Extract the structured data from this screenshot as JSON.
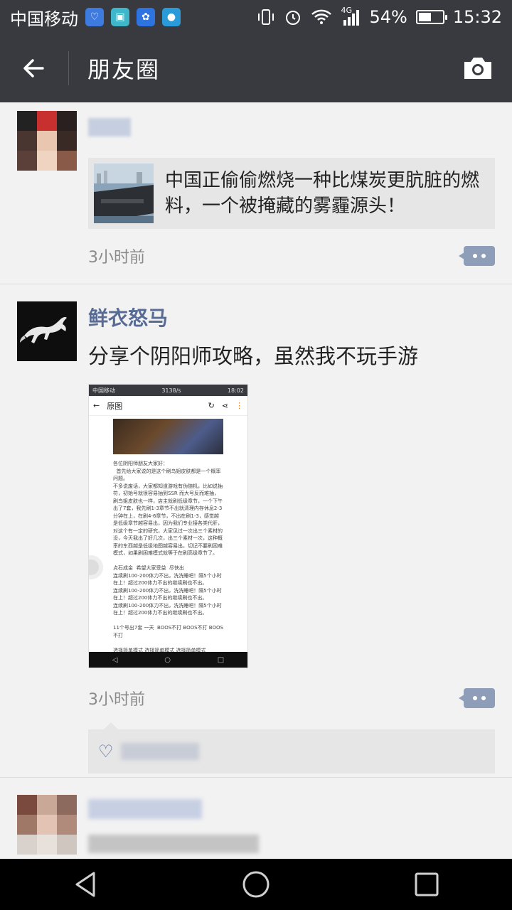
{
  "status_bar": {
    "carrier": "中国移动",
    "network": "4G",
    "battery": "54%",
    "battery_level": 0.54,
    "time": "15:32"
  },
  "header": {
    "title": "朋友圈",
    "back_icon": "arrow-left-icon",
    "camera_icon": "camera-icon"
  },
  "posts": [
    {
      "link_title": "中国正偷偷燃烧一种比煤炭更肮脏的燃料，一个被掩藏的雾霾源头！",
      "time": "3小时前"
    },
    {
      "name": "鲜衣怒马",
      "text": "分享个阴阳师攻略，虽然我不玩手游",
      "time": "3小时前",
      "shot": {
        "carrier": "中国移动",
        "speed": "3138/s",
        "time": "18:02",
        "title": "原图",
        "body": "各位阴阳师朋友大家好：\n  首先给大家说的是这个刷鸟姐皮肤都是一个概率问题。\n不多说废话，大家都知道游戏有伪随机，比如说抽符，初始号就很容易抽到SSR 而大号反而难抽，刷鸟姐皮肤也一样，店主就刷低级章节，一个下午出了7套，我先刷1-3章节不出就清理内存休息2-3分钟在上，在刷4-6章节，不出在刷1-3，感觉越是低级章节越容易出，因为我们专业接各类代肝，对这个有一定的研究，大家见过一次出三个素材的没，今天我出了好几次，出三个素材一次，这种概率的东西越是低级地图越容易出，切记不要刷困难模式，如果刷困难模式就等于在刷高级章节了。\n\n点石成金  希望大家受益  尽快出\n连续刷100-200体力不出，洗洗睡吧！隔5个小时在上！超过200体力不出的继续刷也不出。\n连续刷100-200体力不出，洗洗睡吧！隔5个小时在上！超过200体力不出的继续刷也不出。\n连续刷100-200体力不出，洗洗睡吧！隔5个小时在上！超过200体力不出的继续刷也不出。\n\n11个号出7套 一天  BOOS不打 BOOS不打 BOOS不打\n\n选择简单模式 选择简单模式 选择简单模式"
      }
    }
  ]
}
